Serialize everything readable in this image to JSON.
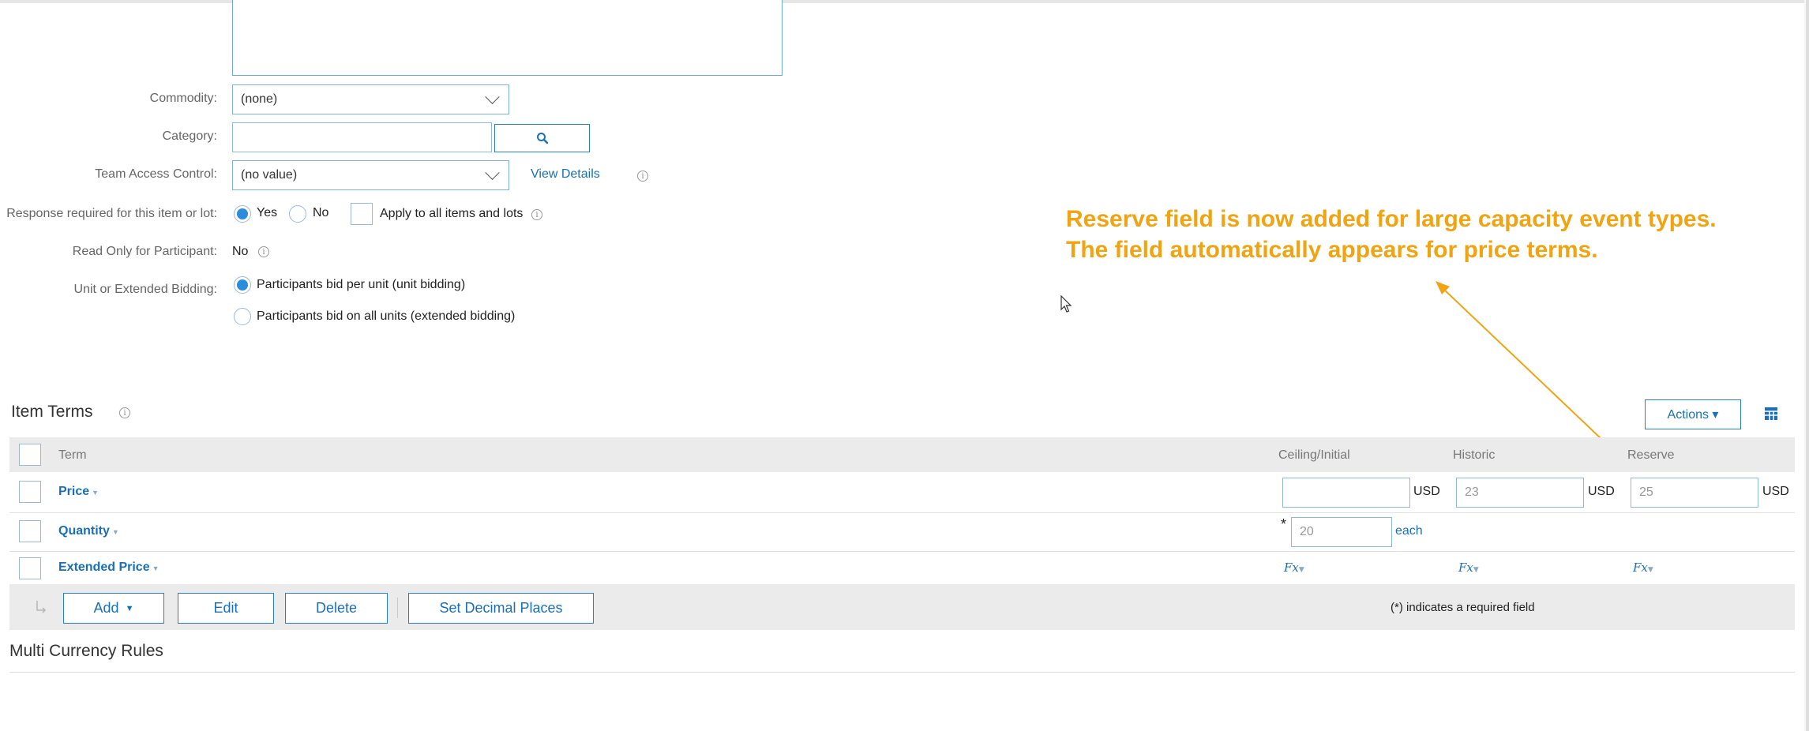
{
  "form": {
    "commodity": {
      "label": "Commodity:",
      "value": "(none)"
    },
    "category": {
      "label": "Category:",
      "value": ""
    },
    "team_access": {
      "label": "Team Access Control:",
      "value": "(no value)",
      "link": "View Details",
      "info": "i"
    },
    "response_required": {
      "label": "Response required for this item or lot:",
      "yes": "Yes",
      "no": "No",
      "apply_all": "Apply to all items and lots",
      "info": "i"
    },
    "read_only": {
      "label": "Read Only for Participant:",
      "value": "No",
      "info": "i"
    },
    "bidding": {
      "label": "Unit or Extended Bidding:",
      "option1": "Participants bid per unit (unit bidding)",
      "option2": "Participants bid on all units (extended bidding)"
    }
  },
  "item_terms": {
    "title": "Item Terms",
    "info": "i",
    "actions_label": "Actions ▾",
    "columns": {
      "term": "Term",
      "ceiling": "Ceiling/Initial",
      "historic": "Historic",
      "reserve": "Reserve"
    },
    "rows": [
      {
        "term": "Price",
        "ceiling_value": "",
        "ceiling_unit": "USD",
        "historic_value": "23",
        "historic_unit": "USD",
        "reserve_value": "25",
        "reserve_unit": "USD"
      },
      {
        "term": "Quantity",
        "required_marker": "*",
        "ceiling_value": "20",
        "ceiling_unit": "each"
      },
      {
        "term": "Extended Price",
        "fx": "Fx"
      }
    ],
    "footer": {
      "add": "Add",
      "edit": "Edit",
      "delete": "Delete",
      "decimal": "Set Decimal Places",
      "required_note": "(*) indicates a required field"
    }
  },
  "multi_currency": {
    "title": "Multi Currency Rules"
  },
  "callout": {
    "line1": "Reserve field is now added for large capacity event types.",
    "line2": "The field automatically appears for price terms.",
    "color": "#eea413"
  }
}
